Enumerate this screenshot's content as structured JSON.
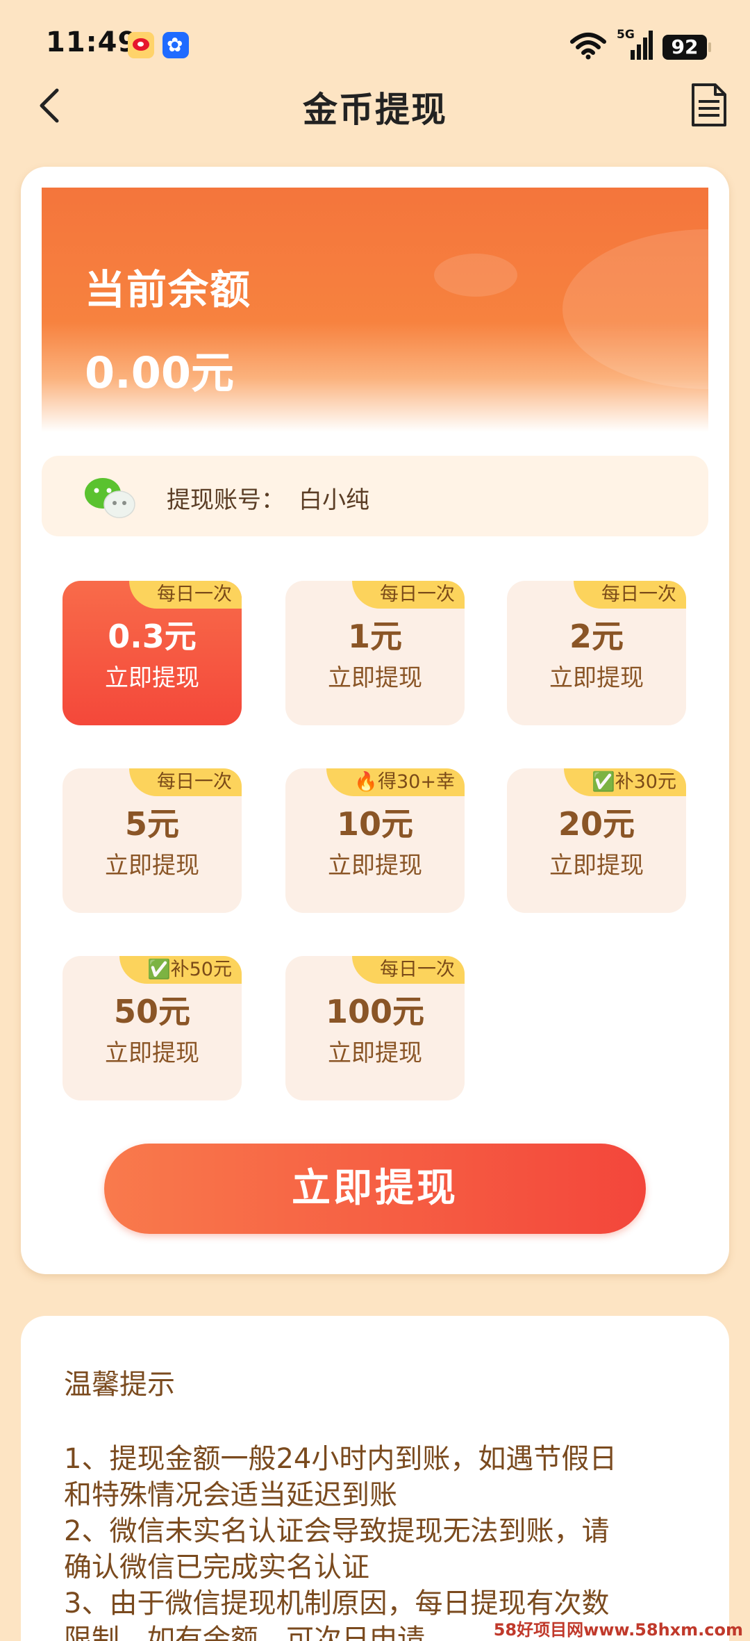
{
  "status_bar": {
    "time": "11:49",
    "signal_label": "5G",
    "battery": "92",
    "icons": [
      "weibo-icon",
      "pinwheel-icon",
      "wifi-icon",
      "signal-icon"
    ]
  },
  "nav": {
    "title": "金币提现",
    "back_icon": "chevron-left-icon",
    "record_icon": "document-icon"
  },
  "balance": {
    "label": "当前余额",
    "value": "0.00元"
  },
  "account": {
    "label": "提现账号：",
    "name": "白小纯",
    "icon": "wechat-icon"
  },
  "options": [
    {
      "amount": "0.3元",
      "action": "立即提现",
      "tag": "每日一次",
      "selected": true
    },
    {
      "amount": "1元",
      "action": "立即提现",
      "tag": "每日一次",
      "selected": false
    },
    {
      "amount": "2元",
      "action": "立即提现",
      "tag": "每日一次",
      "selected": false
    },
    {
      "amount": "5元",
      "action": "立即提现",
      "tag": "每日一次",
      "selected": false
    },
    {
      "amount": "10元",
      "action": "立即提现",
      "tag": "🔥得30+幸",
      "selected": false
    },
    {
      "amount": "20元",
      "action": "立即提现",
      "tag": "✅补30元",
      "selected": false
    },
    {
      "amount": "50元",
      "action": "立即提现",
      "tag": "✅补50元",
      "selected": false
    },
    {
      "amount": "100元",
      "action": "立即提现",
      "tag": "每日一次",
      "selected": false
    }
  ],
  "withdraw_button": "立即提现",
  "tips": {
    "title": "温馨提示",
    "lines": [
      "1、提现金额一般24小时内到账，如遇节假日",
      "和特殊情况会适当延迟到账",
      "2、微信未实名认证会导致提现无法到账，请",
      "确认微信已完成实名认证",
      "3、由于微信提现机制原因，每日提现有次数",
      "限制，如有余额，可次日申请"
    ]
  },
  "watermark": "58好项目网www.58hxm.com",
  "colors": {
    "background": "#fde4c3",
    "accent": "#f4483a",
    "tag": "#fcd35c",
    "text_brown": "#8a5526"
  }
}
